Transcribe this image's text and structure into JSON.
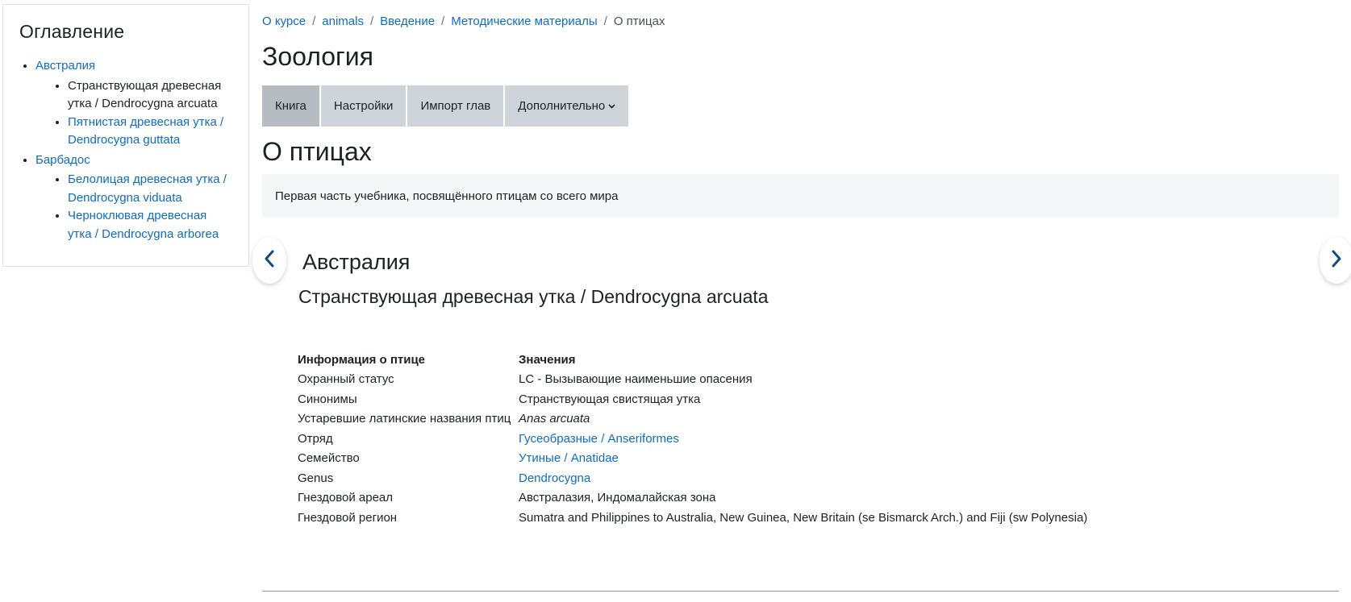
{
  "toc": {
    "title": "Оглавление",
    "items": [
      {
        "label": "Австралия",
        "children": [
          {
            "label": "Странствующая древесная утка / Dendrocygna arcuata",
            "current": true
          },
          {
            "label": "Пятнистая древесная утка / Dendrocygna guttata",
            "current": false
          }
        ]
      },
      {
        "label": "Барбадос",
        "children": [
          {
            "label": "Белолицая древесная утка / Dendrocygna viduata",
            "current": false
          },
          {
            "label": "Черноклювая древесная утка / Dendrocygna arborea",
            "current": false
          }
        ]
      }
    ]
  },
  "breadcrumb": {
    "items": [
      "О курсе",
      "animals",
      "Введение",
      "Методические материалы"
    ],
    "current": "О птицах",
    "separator": "/"
  },
  "page_title": "Зоология",
  "tabs": [
    {
      "label": "Книга",
      "active": true
    },
    {
      "label": "Настройки",
      "active": false
    },
    {
      "label": "Импорт глав",
      "active": false
    },
    {
      "label": "Дополнительно",
      "active": false,
      "dropdown": true
    }
  ],
  "section_title": "О птицах",
  "summary": "Первая часть учебника, посвящённого птицам со всего мира",
  "chapter": {
    "title": "Австралия",
    "subtitle": "Странствующая древесная утка / Dendrocygna arcuata"
  },
  "table": {
    "headers": [
      "Информация о птице",
      "Значения"
    ],
    "rows": [
      {
        "key": "Охранный статус",
        "value": "LC - Вызывающие наименьшие опасения",
        "type": "text"
      },
      {
        "key": "Синонимы",
        "value": "Странствующая свистящая утка",
        "type": "text"
      },
      {
        "key": "Устаревшие латинские названия птиц",
        "value": "Anas arcuata",
        "type": "italic"
      },
      {
        "key": "Отряд",
        "value": "Гусеобразные / Anseriformes",
        "type": "link"
      },
      {
        "key": "Семейство",
        "value": "Утиные / Anatidae",
        "type": "link"
      },
      {
        "key": "Genus",
        "value": "Dendrocygna",
        "type": "link"
      },
      {
        "key": "Гнездовой ареал",
        "value": "Австралазия, Индомалайская зона",
        "type": "text"
      },
      {
        "key": "Гнездовой регион",
        "value": "Sumatra and Philippines to Australia, New Guinea, New Britain (se Bismarck Arch.) and Fiji (sw Polynesia)",
        "type": "text"
      }
    ]
  },
  "icons": {
    "prev": "chevron-left-icon",
    "next": "chevron-right-icon",
    "dropdown": "chevron-down-icon"
  },
  "colors": {
    "link": "#0f6cbf",
    "text": "#1d2125",
    "tab_bg": "#ced4da",
    "tab_active_bg": "#b6bcc2",
    "summary_bg": "#f5f6f8",
    "nav_arrow": "#0f4c81"
  }
}
